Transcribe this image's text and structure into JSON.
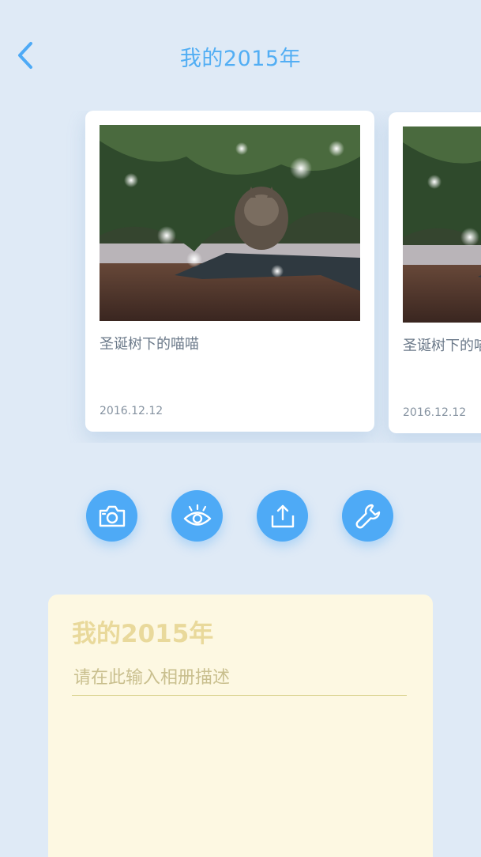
{
  "header": {
    "title": "我的2015年",
    "back_icon": "chevron-left-icon"
  },
  "colors": {
    "accent": "#4eaaf6",
    "background": "#dfeaf6",
    "note_bg": "#fdf8e2",
    "note_title": "#e9d99b"
  },
  "cards": [
    {
      "title": "圣诞树下的喵喵",
      "date": "2016.12.12"
    },
    {
      "title": "圣诞树下的喵喵",
      "date": "2016.12.12"
    }
  ],
  "actions": [
    {
      "icon": "camera-icon"
    },
    {
      "icon": "eye-icon"
    },
    {
      "icon": "upload-icon"
    },
    {
      "icon": "wrench-icon"
    }
  ],
  "note": {
    "title": "我的2015年",
    "placeholder": "请在此输入相册描述"
  }
}
